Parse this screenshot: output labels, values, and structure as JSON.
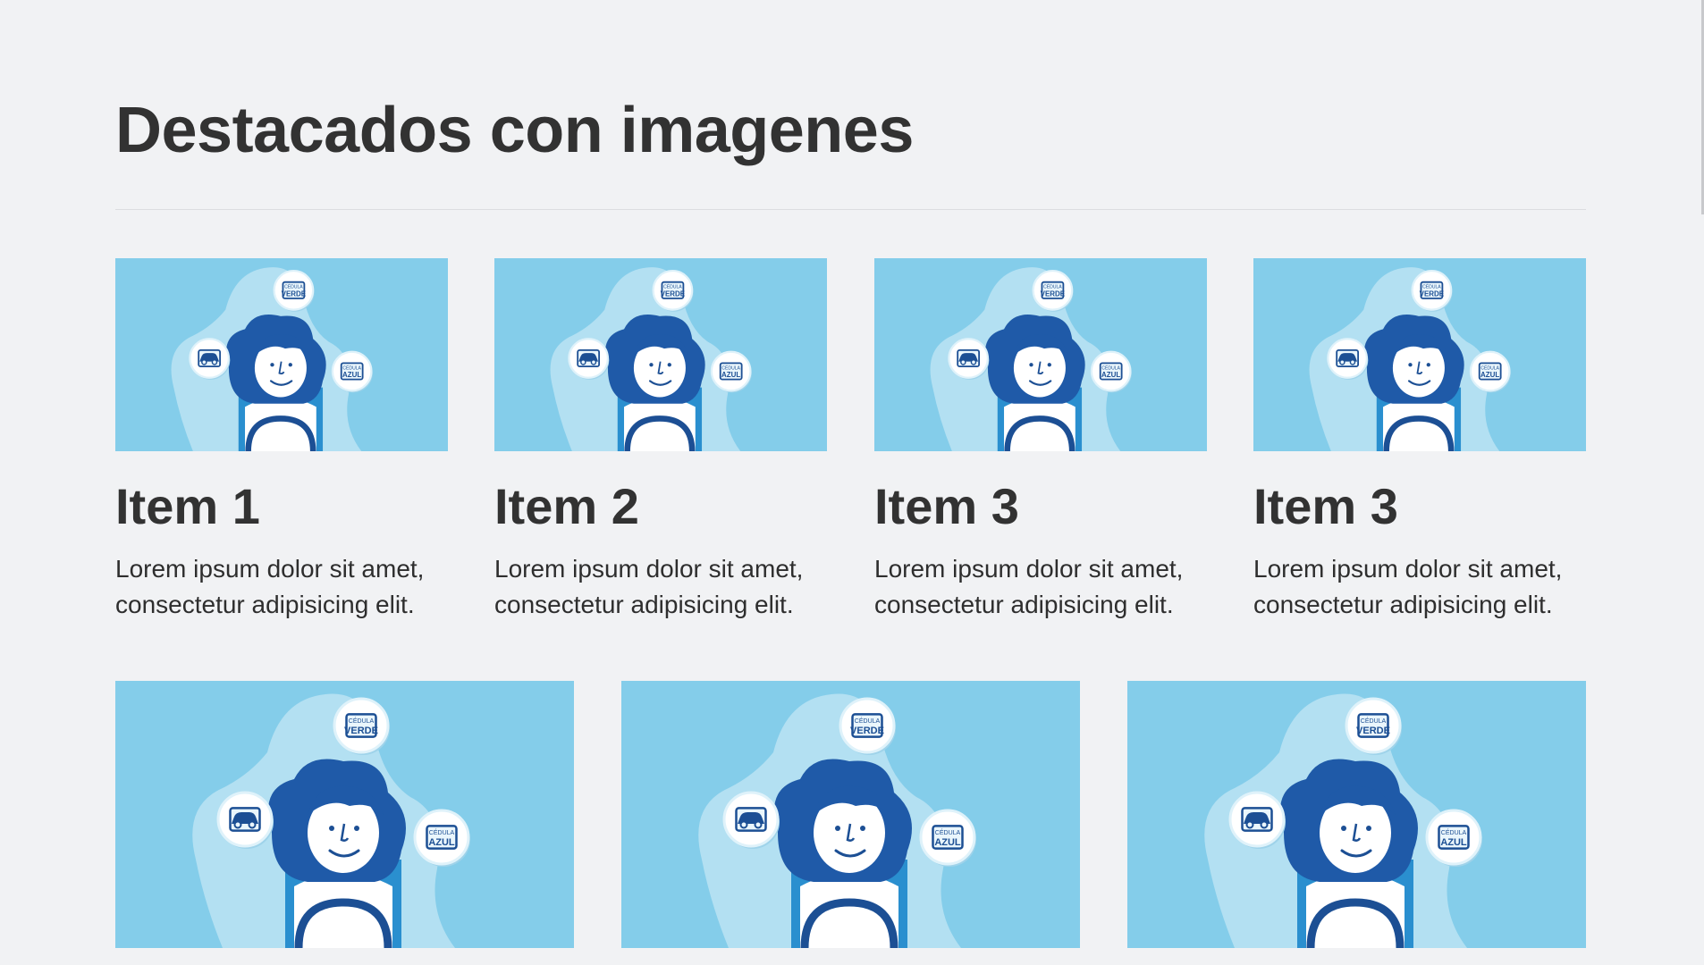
{
  "section": {
    "title": "Destacados con imagenes"
  },
  "illustration": {
    "badge_top_small": "CÉDULA",
    "badge_top_big": "VERDE",
    "badge_right_small": "CÉDULA",
    "badge_right_big": "AZUL",
    "background_color": "#84cdea",
    "blob_color": "#b3e0f2",
    "hair_color": "#1f5aa8",
    "outline_color": "#1c4f94"
  },
  "row1": [
    {
      "title": "Item 1",
      "text": "Lorem ipsum dolor sit amet, consectetur adipisicing elit."
    },
    {
      "title": "Item 2",
      "text": "Lorem ipsum dolor sit amet, consectetur adipisicing elit."
    },
    {
      "title": "Item 3",
      "text": "Lorem ipsum dolor sit amet, consectetur adipisicing elit."
    },
    {
      "title": "Item 3",
      "text": "Lorem ipsum dolor sit amet, consectetur adipisicing elit."
    }
  ],
  "row2_count": 3
}
